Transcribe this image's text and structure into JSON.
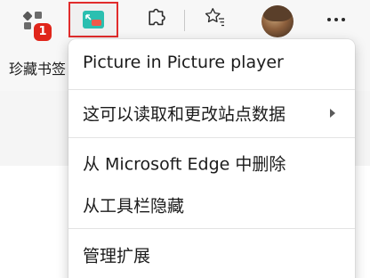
{
  "toolbar": {
    "collections_badge": "1"
  },
  "favorites_bar": {
    "visible_text": "珍藏书签"
  },
  "menu": {
    "items": [
      {
        "label": "Picture in Picture player"
      },
      {
        "label": "这可以读取和更改站点数据",
        "has_submenu": true
      },
      {
        "label": "从 Microsoft Edge 中删除"
      },
      {
        "label": "从工具栏隐藏"
      },
      {
        "label": "管理扩展"
      }
    ]
  },
  "colors": {
    "highlight_border": "#e12c2c",
    "badge": "#e0251a",
    "pip_icon_teal": "#2bbfb0",
    "pip_icon_red": "#f05a4a"
  },
  "icons": [
    "collections-icon",
    "pip-extension-icon",
    "extensions-icon",
    "favorites-icon",
    "profile-avatar",
    "more-icon",
    "chevron-right-icon"
  ]
}
